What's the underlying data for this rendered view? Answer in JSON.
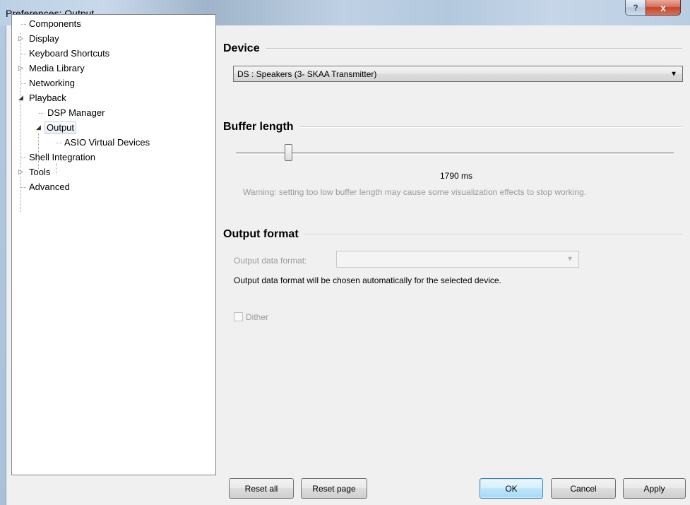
{
  "window": {
    "title": "Preferences: Output",
    "help_label": "?",
    "close_label": "x"
  },
  "tree": {
    "items": [
      {
        "label": "Components"
      },
      {
        "label": "Display",
        "expander": "▷"
      },
      {
        "label": "Keyboard Shortcuts"
      },
      {
        "label": "Media Library",
        "expander": "▷"
      },
      {
        "label": "Networking"
      },
      {
        "label": "Playback",
        "expander": "◢"
      },
      {
        "label": "DSP Manager"
      },
      {
        "label": "Output",
        "expander": "◢",
        "selected": true
      },
      {
        "label": "ASIO Virtual Devices"
      },
      {
        "label": "Shell Integration"
      },
      {
        "label": "Tools",
        "expander": "▷"
      },
      {
        "label": "Advanced"
      }
    ]
  },
  "device": {
    "heading": "Device",
    "selected": "DS : Speakers (3- SKAA Transmitter)",
    "arrow": "▼"
  },
  "buffer": {
    "heading": "Buffer length",
    "value_text": "1790 ms",
    "level": 0.12,
    "warning": "Warning: setting too low buffer length may cause some visualization effects to stop working."
  },
  "output_format": {
    "heading": "Output format",
    "format_label": "Output data format:",
    "format_value": "",
    "arrow": "▼",
    "auto_note": "Output data format will be chosen automatically for the selected device.",
    "dither_label": "Dither",
    "dither_checked": false
  },
  "buttons": {
    "reset_all": "Reset all",
    "reset_page": "Reset page",
    "ok": "OK",
    "cancel": "Cancel",
    "apply": "Apply"
  }
}
